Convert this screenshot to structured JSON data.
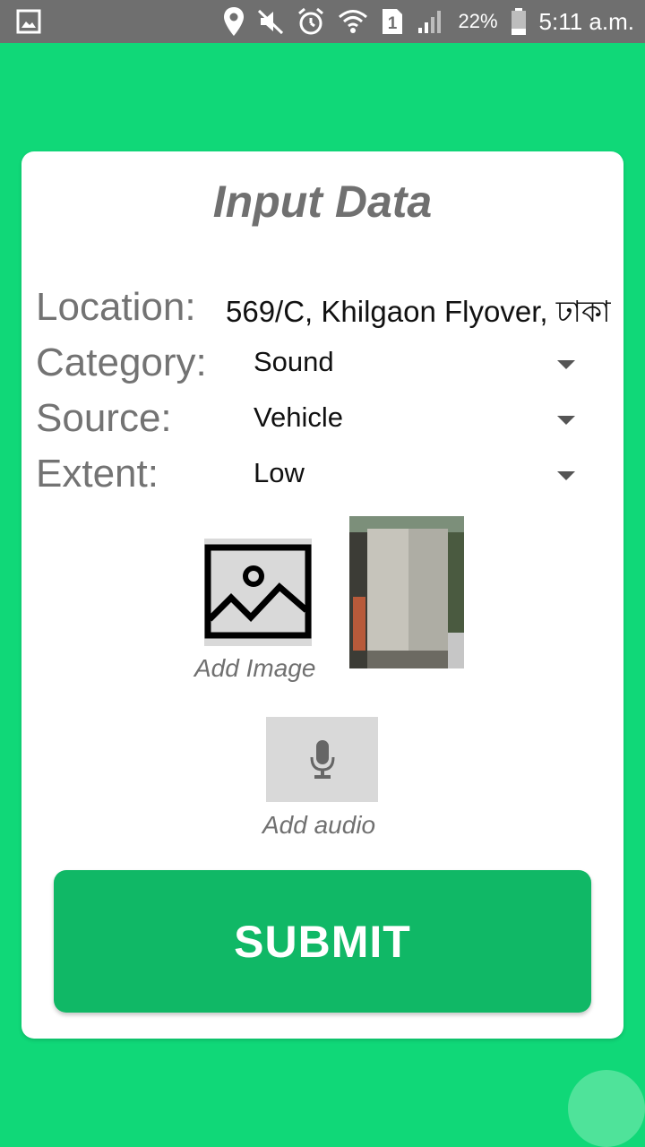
{
  "status_bar": {
    "battery_percent": "22%",
    "time": "5:11 a.m.",
    "sim_slot": "1",
    "icons": [
      "gallery-icon",
      "location-icon",
      "mute-icon",
      "alarm-icon",
      "wifi-icon",
      "sim-icon",
      "signal-icon",
      "battery-icon"
    ]
  },
  "form": {
    "title": "Input Data",
    "location_label": "Location:",
    "location_value": "569/C, Khilgaon Flyover, ঢাকা",
    "category_label": "Category:",
    "category_value": "Sound",
    "source_label": "Source:",
    "source_value": "Vehicle",
    "extent_label": "Extent:",
    "extent_value": "Low",
    "add_image_label": "Add Image",
    "add_audio_label": "Add audio",
    "submit_label": "SUBMIT"
  },
  "colors": {
    "background": "#10d878",
    "button": "#10b866",
    "status_bar": "#6f6f6f"
  }
}
